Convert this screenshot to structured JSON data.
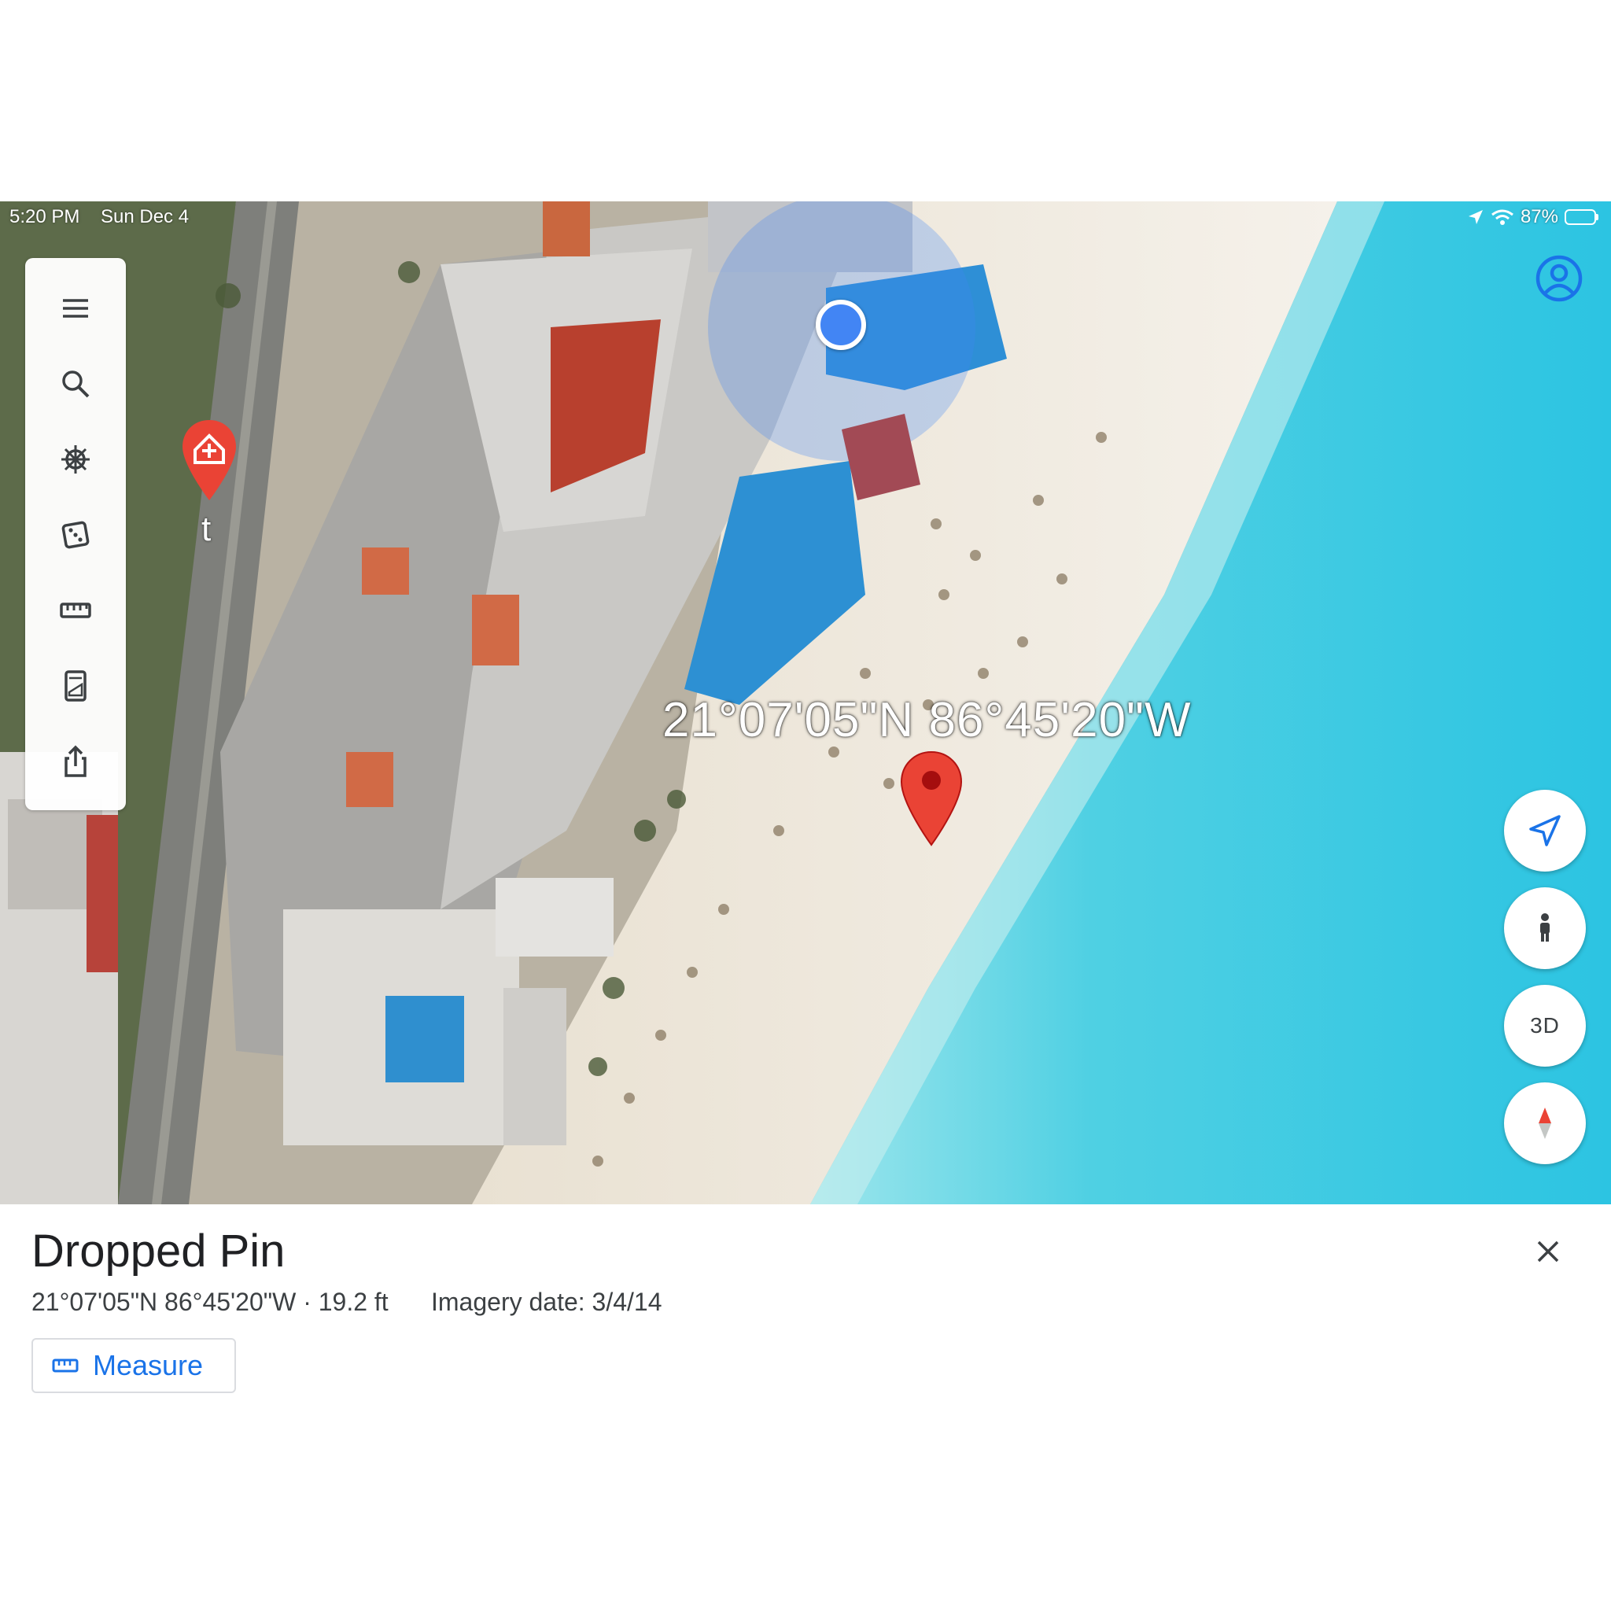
{
  "status_bar": {
    "time": "5:20 PM",
    "date": "Sun Dec 4",
    "battery": "87%",
    "battery_level": 0.87,
    "icons": [
      "location-arrow-icon",
      "wifi-icon",
      "battery-icon"
    ]
  },
  "toolbar": {
    "items": [
      {
        "icon": "menu-icon"
      },
      {
        "icon": "search-icon"
      },
      {
        "icon": "voyager-wheel-icon"
      },
      {
        "icon": "dice-icon"
      },
      {
        "icon": "ruler-icon"
      },
      {
        "icon": "projects-icon"
      },
      {
        "icon": "share-icon"
      }
    ]
  },
  "map": {
    "coordinate_label": "21°07'05\"N 86°45'20\"W",
    "house_marker_letter": "t",
    "pin_color": "#ea4335",
    "location_dot_color": "#4285f4"
  },
  "controls": {
    "locate_icon": "navigation-arrow-icon",
    "street_view_icon": "pegman-icon",
    "view_mode_label": "3D",
    "compass_icon": "compass-icon"
  },
  "place": {
    "title": "Dropped Pin",
    "coords_line": "21°07'05\"N 86°45'20\"W · 19.2 ft",
    "imagery_date": "Imagery date: 3/4/14",
    "measure_label": "Measure",
    "close_icon": "close-icon",
    "accent_color": "#1a73e8"
  }
}
